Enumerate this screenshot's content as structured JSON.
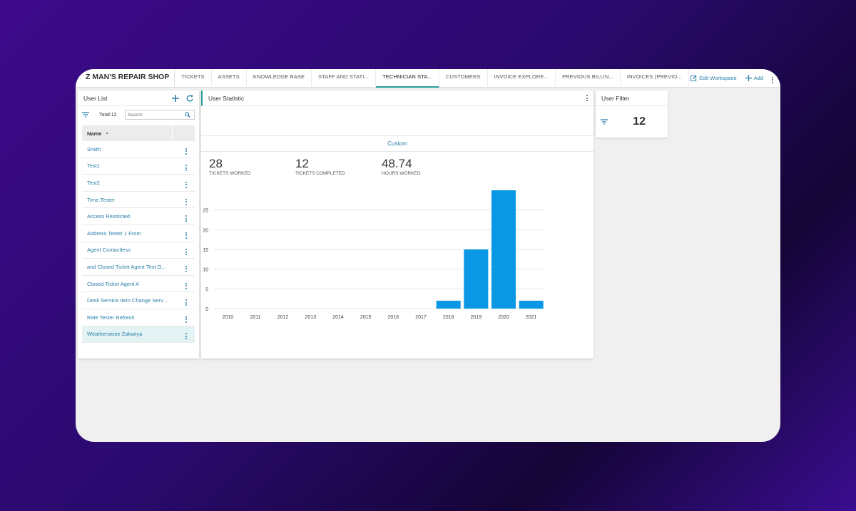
{
  "app": {
    "brand": "Z MAN'S REPAIR SHOP"
  },
  "tabs": [
    {
      "label": "TICKETS",
      "active": false
    },
    {
      "label": "ASSETS",
      "active": false
    },
    {
      "label": "KNOWLEDGE BASE",
      "active": false
    },
    {
      "label": "STAFF AND STATI...",
      "active": false
    },
    {
      "label": "TECHNICIAN STA...",
      "active": true
    },
    {
      "label": "CUSTOMERS",
      "active": false
    },
    {
      "label": "INVOICE EXPLORE...",
      "active": false
    },
    {
      "label": "PREVIOUS BILLIN...",
      "active": false
    },
    {
      "label": "INVOICES (PREVIO...",
      "active": false
    }
  ],
  "nav": {
    "edit_workspace": "Edit Workspace",
    "add": "Add"
  },
  "user_list": {
    "title": "User List",
    "total": "Total:12",
    "search_placeholder": "Search",
    "column_name": "Name",
    "users": [
      {
        "name": "Smith"
      },
      {
        "name": "Test1"
      },
      {
        "name": "Test2"
      },
      {
        "name": "Time.Tester"
      },
      {
        "name": "Access Restricted"
      },
      {
        "name": "Address Tester 1 From"
      },
      {
        "name": "Agent Contactless"
      },
      {
        "name": "and Closed Ticket Agent Test O..."
      },
      {
        "name": "Closed Ticket Agent A"
      },
      {
        "name": "Desk Service Item Change Serv..."
      },
      {
        "name": "Rate Tester Refresh"
      },
      {
        "name": "Weatherstone Zakariya",
        "selected": true
      }
    ]
  },
  "user_statistic": {
    "title": "User Statistic",
    "range_label": "Custom",
    "kpis": [
      {
        "value": "28",
        "label": "TICKETS WORKED"
      },
      {
        "value": "12",
        "label": "TICKETS COMPLETED"
      },
      {
        "value": "48.74",
        "label": "HOURS WORKED"
      }
    ]
  },
  "user_filter": {
    "title": "User Filter",
    "count": "12"
  },
  "colors": {
    "accent": "#2a9d9f",
    "link": "#2a7fa8",
    "bar": "#0a97e3"
  },
  "chart_data": {
    "type": "bar",
    "categories": [
      "2010",
      "2011",
      "2012",
      "2013",
      "2014",
      "2015",
      "2016",
      "2017",
      "2018",
      "2019",
      "2020",
      "2021"
    ],
    "values": [
      0,
      0,
      0,
      0,
      0,
      0,
      0,
      0,
      2,
      15,
      30,
      2
    ],
    "yticks": [
      0,
      5,
      10,
      15,
      20,
      25
    ],
    "ylim": [
      0,
      30
    ],
    "grid": true,
    "title": "",
    "xlabel": "",
    "ylabel": ""
  }
}
